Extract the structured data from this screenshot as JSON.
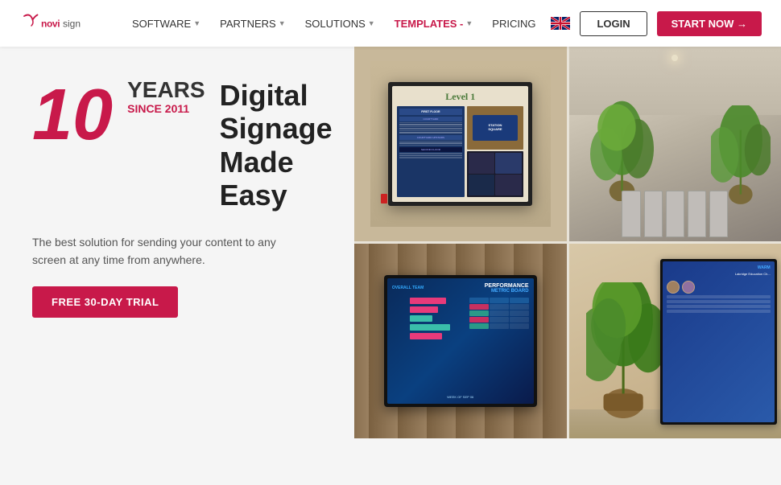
{
  "brand": {
    "name": "NoviSign",
    "logo_text": "novisign"
  },
  "navbar": {
    "links": [
      {
        "label": "SOFTWARE",
        "has_dropdown": true
      },
      {
        "label": "PARTNERS",
        "has_dropdown": true
      },
      {
        "label": "SOLUTIONS",
        "has_dropdown": true
      },
      {
        "label": "TEMPLATES",
        "has_dropdown": true,
        "active": true
      },
      {
        "label": "PRICING",
        "has_dropdown": false
      }
    ],
    "login_label": "LOGIN",
    "start_label": "START NOW →",
    "templates_dash": "TEMPLATES -"
  },
  "hero": {
    "number": "10",
    "years": "YEARS",
    "since": "SINCE 2011",
    "title": "Digital\nSignage\nMade Easy",
    "subtitle": "The best solution for sending your content to any screen at any time from anywhere.",
    "cta": "FREE 30-DAY TRIAL"
  },
  "images": [
    {
      "id": "img1",
      "alt": "Directory display Level 1 station square"
    },
    {
      "id": "img2",
      "alt": "Conference room with chairs and plants"
    },
    {
      "id": "img3",
      "alt": "Performance Metric Board digital signage"
    },
    {
      "id": "img4",
      "alt": "Indoor display with plant - education church"
    }
  ],
  "metric_board": {
    "title": "PERFORMANCE",
    "subtitle": "METRIC BOARD",
    "week_label": "WEEK OF SEP 06",
    "team_label": "OVERALL TEAM"
  }
}
